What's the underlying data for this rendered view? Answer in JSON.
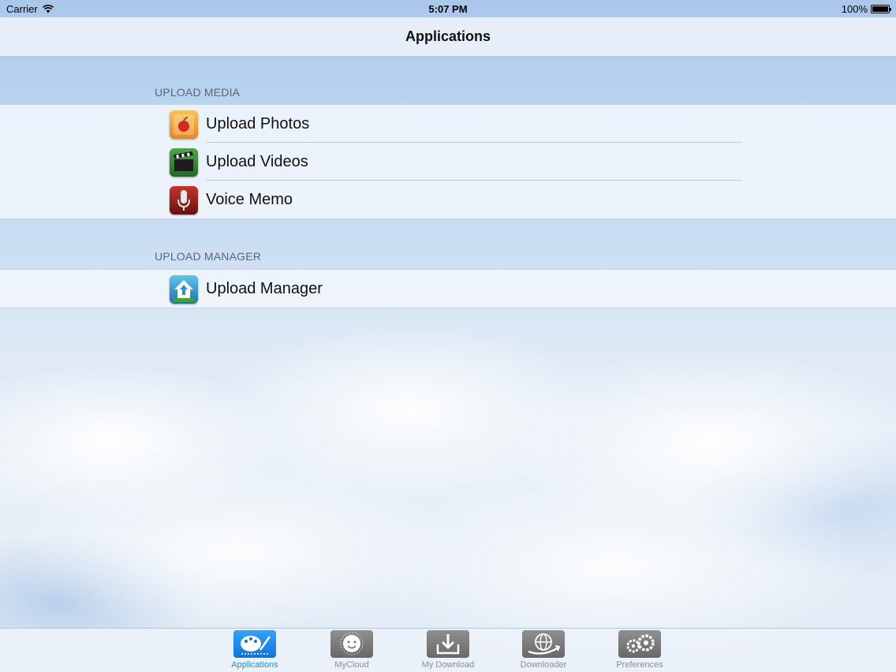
{
  "status_bar": {
    "carrier": "Carrier",
    "time": "5:07 PM",
    "battery": "100%"
  },
  "nav": {
    "title": "Applications"
  },
  "sections": [
    {
      "header": "UPLOAD MEDIA",
      "items": [
        {
          "label": "Upload Photos",
          "icon": "photos-icon"
        },
        {
          "label": "Upload Videos",
          "icon": "clapper-icon"
        },
        {
          "label": "Voice Memo",
          "icon": "microphone-icon"
        }
      ]
    },
    {
      "header": "UPLOAD MANAGER",
      "items": [
        {
          "label": "Upload Manager",
          "icon": "home-upload-icon"
        }
      ]
    }
  ],
  "tabs": [
    {
      "label": "Applications",
      "active": true
    },
    {
      "label": "MyCloud",
      "active": false
    },
    {
      "label": "My Download",
      "active": false
    },
    {
      "label": "Downloader",
      "active": false
    },
    {
      "label": "Preferences",
      "active": false
    }
  ],
  "colors": {
    "accent": "#1a8ff0",
    "inactive_tab": "#8a8f96"
  }
}
